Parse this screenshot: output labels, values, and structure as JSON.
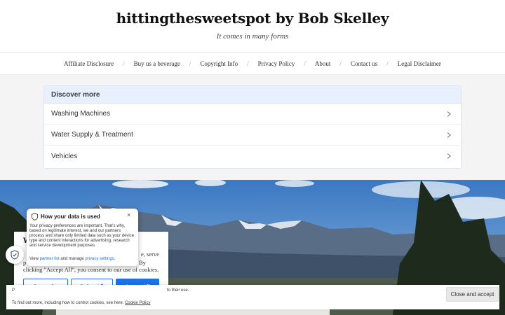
{
  "site": {
    "title": "hittingthesweetspot by Bob Skelley",
    "tagline": "It comes in many forms"
  },
  "nav": {
    "items": [
      {
        "label": "Affiliate Disclosure"
      },
      {
        "label": "Buy us a beverage"
      },
      {
        "label": "Copyright Info"
      },
      {
        "label": "Privacy Policy"
      },
      {
        "label": "About"
      },
      {
        "label": "Contact us"
      },
      {
        "label": "Legal Disclaimer"
      }
    ],
    "separator": "/"
  },
  "discover": {
    "heading": "Discover more",
    "items": [
      {
        "label": "Washing Machines",
        "icon": "chevron-right-icon"
      },
      {
        "label": "Water Supply & Treatment",
        "icon": "chevron-right-icon"
      },
      {
        "label": "Vehicles",
        "icon": "chevron-right-icon"
      }
    ]
  },
  "consent_dialog": {
    "heading_partial": "W",
    "text_right_fragment": "e, serve",
    "text_left_fragment": "p",
    "text_by": "By",
    "text_last_line": "clicking \"Accept All\", you consent to our use of cookies.",
    "customize_label": "Customize",
    "reject_label": "Reject All",
    "accept_label": "Accept All"
  },
  "privacy_popover": {
    "title": "How your data is used",
    "close_glyph": "×",
    "body": "Your privacy preferences are important. That's why, based on legitimate interest, we and our partners process and share only limited data such as your device type and content interactions for advertising, research and service development purposes.",
    "links_prefix": "View",
    "partner_list_label": "partner list",
    "links_middle": "and manage",
    "privacy_settings_label": "privacy settings",
    "links_suffix": "."
  },
  "cookie_bar": {
    "line1_fragment": "to their use.",
    "line1_left_fragment": "P",
    "line2_text": "To find out more, including how to control cookies, see here:",
    "line2_link": "Cookie Policy",
    "close_label": "Close and accept"
  },
  "colors": {
    "accent": "#1a73e8",
    "discover_header_bg": "#e8f0fe",
    "sky": "#3f7fc4"
  }
}
